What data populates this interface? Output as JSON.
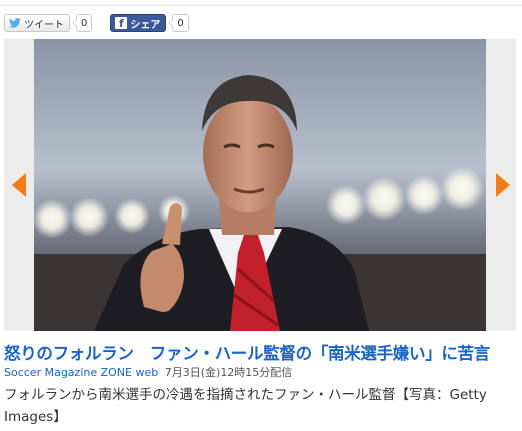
{
  "share": {
    "tweet_label": "ツイート",
    "tweet_count": "0",
    "facebook_label": "シェア",
    "facebook_count": "0"
  },
  "article": {
    "headline": "怒りのフォルラン　ファン・ハール監督の「南米選手嫌い」に苦言",
    "source": "Soccer Magazine ZONE web",
    "date": "7月3日(金)12時15分配信",
    "caption": "フォルランから南米選手の冷遇を指摘されたファン・ハール監督【写真：Getty Images】"
  },
  "colors": {
    "link": "#1763c6",
    "arrow": "#f07c1a",
    "facebook": "#3b5998"
  },
  "icons": {
    "tweet": "bird-icon",
    "facebook": "facebook-f-icon",
    "prev": "arrow-left-icon",
    "next": "arrow-right-icon"
  }
}
